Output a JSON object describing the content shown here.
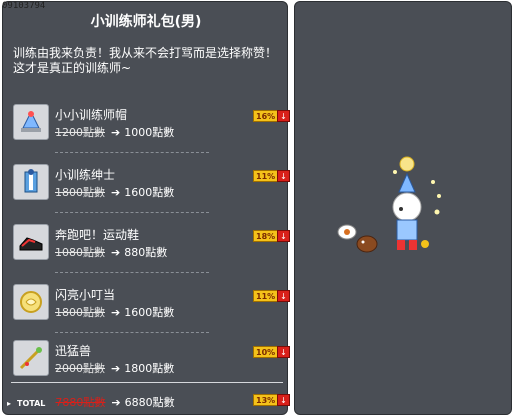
{
  "item_id": "09103794",
  "title": "小训练师礼包(男)",
  "description": "训练由我来负责！我从来不会打骂而是选择称赞！这才是真正的训练师~",
  "currency": "點數",
  "items": [
    {
      "name": "小小训练师帽",
      "old_price": "1200點數",
      "new_price": "1000點數",
      "discount": "16%",
      "icon": "hat-icon"
    },
    {
      "name": "小训练绅士",
      "old_price": "1800點數",
      "new_price": "1600點數",
      "discount": "11%",
      "icon": "outfit-icon"
    },
    {
      "name": "奔跑吧！运动鞋",
      "old_price": "1080點數",
      "new_price": "880點數",
      "discount": "18%",
      "icon": "shoe-icon"
    },
    {
      "name": "闪亮小叮当",
      "old_price": "1800點數",
      "new_price": "1600點數",
      "discount": "11%",
      "icon": "ring-icon"
    },
    {
      "name": "迅猛兽",
      "old_price": "2000點數",
      "new_price": "1800點數",
      "discount": "10%",
      "icon": "pet-weapon-icon"
    }
  ],
  "total": {
    "label": "TOTAL",
    "old_price": "7880點數",
    "new_price": "6880點數",
    "discount": "13%"
  },
  "colors": {
    "panel": "#4a4e55",
    "badge": "#f4c21a",
    "down": "#d8201a"
  }
}
